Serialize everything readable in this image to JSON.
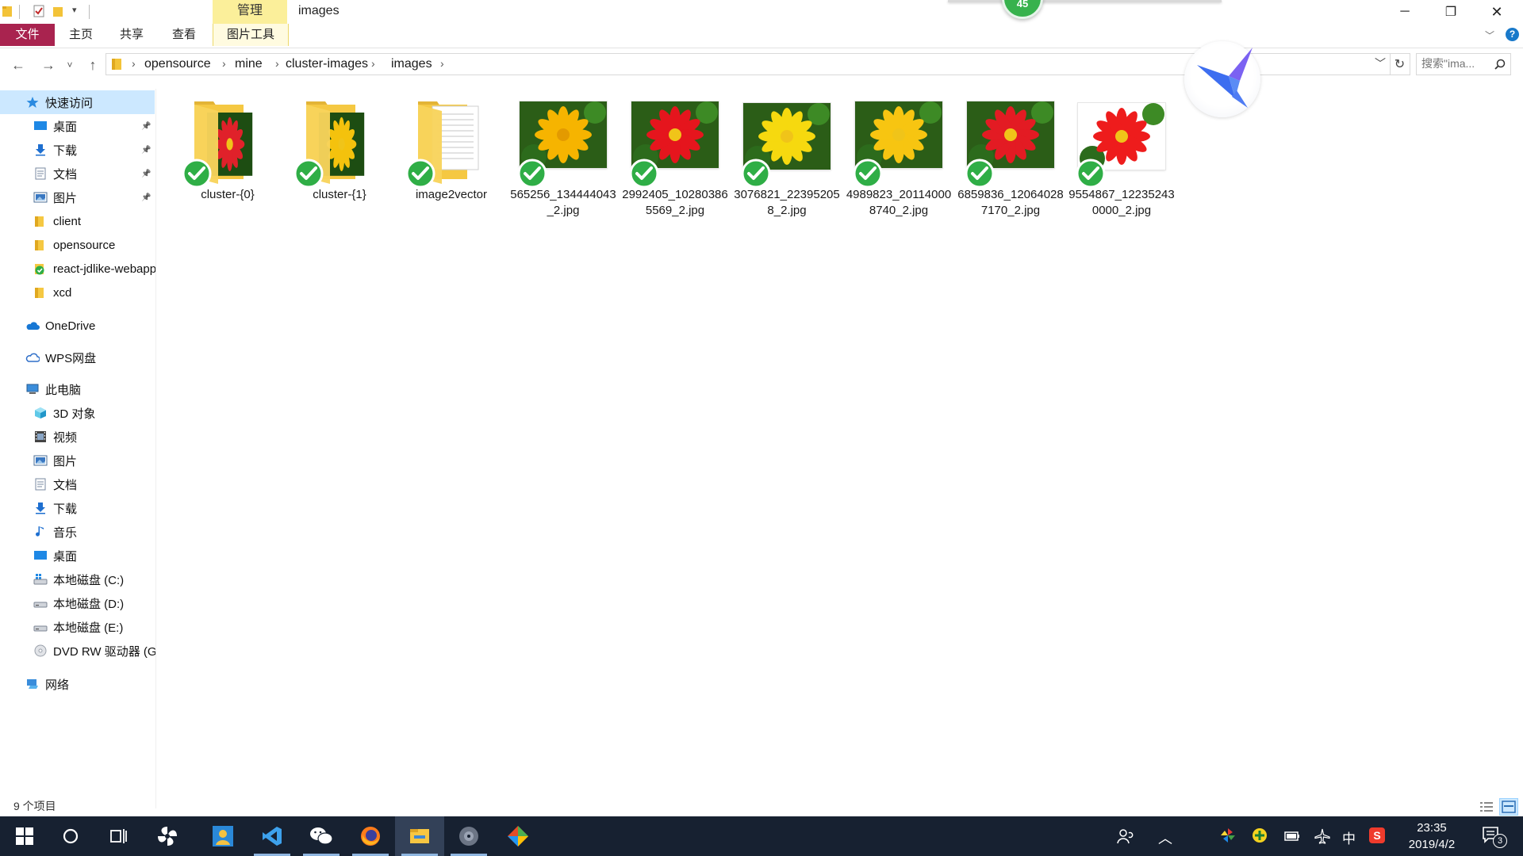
{
  "window": {
    "title": "images",
    "context_tab_head": "管理",
    "minimize": "─",
    "restore": "❐",
    "close": "✕"
  },
  "badge": {
    "count": "45"
  },
  "ribbon": {
    "tabs": [
      {
        "label": "文件",
        "color": "#a9234f"
      },
      {
        "label": "主页"
      },
      {
        "label": "共享"
      },
      {
        "label": "查看"
      },
      {
        "label": "图片工具"
      }
    ],
    "help": "?"
  },
  "nav": {
    "breadcrumbs": [
      "opensource",
      "mine",
      "cluster-images",
      "images"
    ],
    "search_placeholder": "搜索\"ima..."
  },
  "sidebar": {
    "items": [
      {
        "label": "快速访问",
        "icon": "star-icon",
        "level": 0,
        "selected": true
      },
      {
        "label": "桌面",
        "icon": "desktop-icon",
        "level": 1,
        "pinned": true
      },
      {
        "label": "下载",
        "icon": "download-icon",
        "level": 1,
        "pinned": true
      },
      {
        "label": "文档",
        "icon": "document-icon",
        "level": 1,
        "pinned": true
      },
      {
        "label": "图片",
        "icon": "picture-icon",
        "level": 1,
        "pinned": true
      },
      {
        "label": "client",
        "icon": "folder-icon",
        "level": 1
      },
      {
        "label": "opensource",
        "icon": "folder-icon",
        "level": 1
      },
      {
        "label": "react-jdlike-webapp",
        "icon": "synced-folder-icon",
        "level": 1
      },
      {
        "label": "xcd",
        "icon": "folder-icon",
        "level": 1
      },
      {
        "label": "OneDrive",
        "icon": "onedrive-icon",
        "level": 0
      },
      {
        "label": "WPS网盘",
        "icon": "cloud-icon",
        "level": 0
      },
      {
        "label": "此电脑",
        "icon": "computer-icon",
        "level": 0
      },
      {
        "label": "3D 对象",
        "icon": "cube-icon",
        "level": 1
      },
      {
        "label": "视频",
        "icon": "video-icon",
        "level": 1
      },
      {
        "label": "图片",
        "icon": "picture-icon",
        "level": 1
      },
      {
        "label": "文档",
        "icon": "document-icon",
        "level": 1
      },
      {
        "label": "下载",
        "icon": "download-icon",
        "level": 1
      },
      {
        "label": "音乐",
        "icon": "music-icon",
        "level": 1
      },
      {
        "label": "桌面",
        "icon": "desktop-icon",
        "level": 1
      },
      {
        "label": "本地磁盘 (C:)",
        "icon": "system-drive-icon",
        "level": 1
      },
      {
        "label": "本地磁盘 (D:)",
        "icon": "drive-icon",
        "level": 1
      },
      {
        "label": "本地磁盘 (E:)",
        "icon": "drive-icon",
        "level": 1
      },
      {
        "label": "DVD RW 驱动器 (G:)",
        "icon": "dvd-icon",
        "level": 1
      },
      {
        "label": "网络",
        "icon": "network-icon",
        "level": 0
      }
    ]
  },
  "files": [
    {
      "name": "cluster-{0}",
      "type": "folder",
      "flower": "#e0212a"
    },
    {
      "name": "cluster-{1}",
      "type": "folder",
      "flower": "#f4c20d"
    },
    {
      "name": "image2vector",
      "type": "folder",
      "flower": ""
    },
    {
      "name": "565256_134444043_2.jpg",
      "type": "image",
      "flower": "#f6b400"
    },
    {
      "name": "2992405_102803865569_2.jpg",
      "type": "image",
      "flower": "#e5151d"
    },
    {
      "name": "3076821_223952058_2.jpg",
      "type": "image",
      "flower": "#f6d90f"
    },
    {
      "name": "4989823_201140008740_2.jpg",
      "type": "image",
      "flower": "#f7c511"
    },
    {
      "name": "6859836_120640287170_2.jpg",
      "type": "image",
      "flower": "#e31b23"
    },
    {
      "name": "9554867_122352430000_2.jpg",
      "type": "image",
      "flower": "#ee1c1c"
    }
  ],
  "status": {
    "count_text": "9 个项目"
  },
  "taskbar": {
    "apps": [
      "windows-start-icon",
      "search-circle-icon",
      "task-view-icon",
      "pinwheel-app-icon",
      "contacts-app-icon",
      "vscode-icon",
      "wechat-icon",
      "firefox-icon",
      "file-explorer-icon",
      "disc-app-icon",
      "gitkraken-icon"
    ],
    "ime": "中",
    "time": "23:35",
    "date": "2019/4/2",
    "notifications": "3"
  },
  "colors": {
    "selection": "#cce8ff",
    "file_tab": "#a9234f",
    "context_tab": "#fbef9a",
    "taskbar": "#172131",
    "check": "#2fae46"
  }
}
